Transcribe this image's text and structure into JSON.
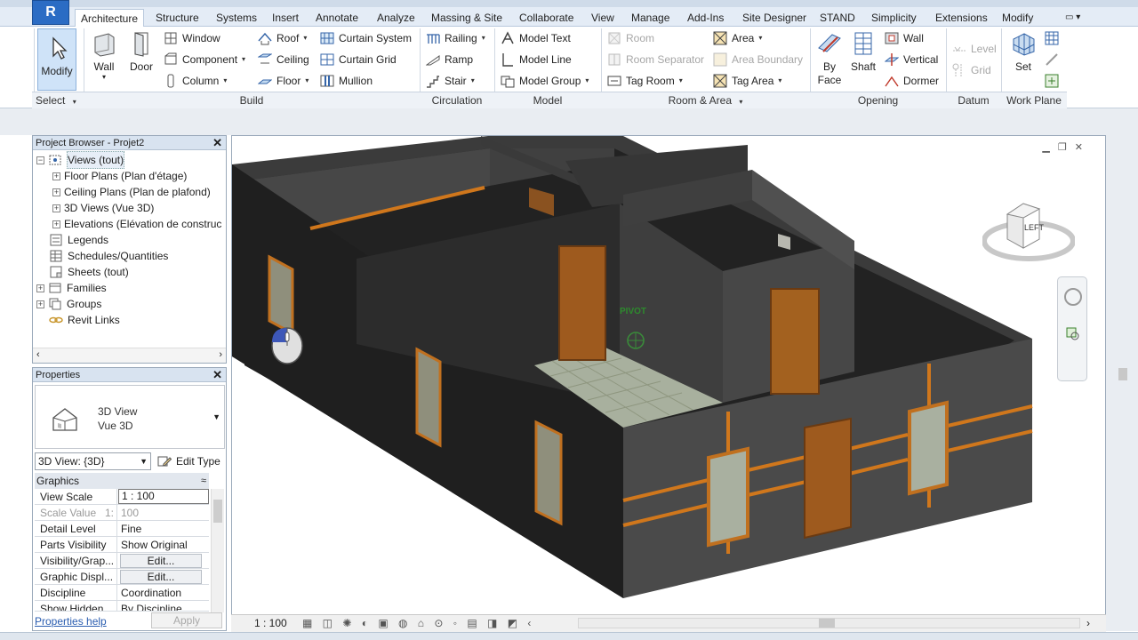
{
  "ribbon": {
    "tabs": [
      "Architecture",
      "Structure",
      "Systems",
      "Insert",
      "Annotate",
      "Analyze",
      "Massing & Site",
      "Collaborate",
      "View",
      "Manage",
      "Add-Ins",
      "Site Designer",
      "STAND",
      "Simplicity",
      "Extensions",
      "Modify"
    ],
    "modify_label": "Modify",
    "select_label": "Select",
    "build": {
      "wall": "Wall",
      "door": "Door",
      "window": "Window",
      "component": "Component",
      "column": "Column",
      "roof": "Roof",
      "ceiling": "Ceiling",
      "floor": "Floor",
      "curtain_system": "Curtain System",
      "curtain_grid": "Curtain Grid",
      "mullion": "Mullion",
      "title": "Build"
    },
    "circulation": {
      "railing": "Railing",
      "ramp": "Ramp",
      "stair": "Stair",
      "title": "Circulation"
    },
    "model": {
      "model_text": "Model Text",
      "model_line": "Model Line",
      "model_group": "Model Group",
      "title": "Model"
    },
    "room_area": {
      "room": "Room",
      "room_separator": "Room Separator",
      "tag_room": "Tag Room",
      "area": "Area",
      "area_boundary": "Area Boundary",
      "tag_area": "Tag Area",
      "title": "Room & Area"
    },
    "opening": {
      "by_face_1": "By",
      "by_face_2": "Face",
      "shaft": "Shaft",
      "wall": "Wall",
      "vertical": "Vertical",
      "dormer": "Dormer",
      "title": "Opening"
    },
    "datum": {
      "level": "Level",
      "grid": "Grid",
      "title": "Datum"
    },
    "work_plane": {
      "set": "Set",
      "title": "Work Plane"
    }
  },
  "project_browser": {
    "title": "Project Browser - Projet2",
    "items": [
      "Views (tout)",
      "Floor Plans (Plan d'étage)",
      "Ceiling Plans (Plan de plafond)",
      "3D Views (Vue 3D)",
      "Elevations (Elévation de construc",
      "Legends",
      "Schedules/Quantities",
      "Sheets (tout)",
      "Families",
      "Groups",
      "Revit Links"
    ]
  },
  "properties": {
    "title": "Properties",
    "type_name_1": "3D View",
    "type_name_2": "Vue 3D",
    "instance_selector": "3D View: {3D}",
    "edit_type": "Edit Type",
    "group": "Graphics",
    "rows": [
      {
        "k": "View Scale",
        "v": "1 : 100"
      },
      {
        "k": "Scale Value",
        "v": "100"
      },
      {
        "k": "Detail Level",
        "v": "Fine"
      },
      {
        "k": "Parts Visibility",
        "v": "Show Original"
      },
      {
        "k": "Visibility/Grap...",
        "v": "Edit..."
      },
      {
        "k": "Graphic Displ...",
        "v": "Edit..."
      },
      {
        "k": "Discipline",
        "v": "Coordination"
      },
      {
        "k": "Show Hidden ...",
        "v": "By Discipline"
      }
    ],
    "scale_value_prefix": "1:",
    "help": "Properties help",
    "apply": "Apply"
  },
  "viewport": {
    "pivot_label": "PIVOT",
    "viewcube_face": "LEFT"
  },
  "view_bar": {
    "scale": "1 : 100"
  }
}
